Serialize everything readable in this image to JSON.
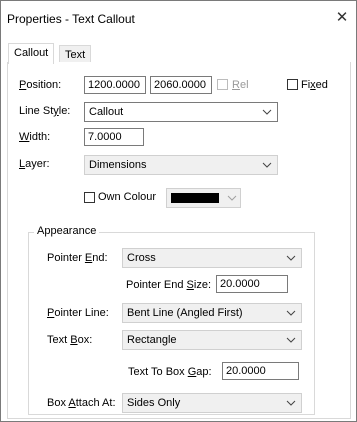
{
  "window": {
    "title": "Properties - Text Callout",
    "close_glyph": "✕"
  },
  "tabs": [
    {
      "label": "Callout",
      "active": true
    },
    {
      "label": "Text",
      "active": false
    }
  ],
  "position": {
    "label": "Position:",
    "x": "1200.0000",
    "y": "2060.0000",
    "rel_label": "Rel",
    "rel_checked": false,
    "rel_enabled": false,
    "fixed_label": "Fixed",
    "fixed_checked": false
  },
  "line_style": {
    "label": "Line Style:",
    "value": "Callout"
  },
  "width": {
    "label": "Width:",
    "value": "7.0000"
  },
  "layer": {
    "label": "Layer:",
    "value": "Dimensions"
  },
  "own_colour": {
    "label": "Own Colour",
    "checked": false,
    "colour": "#000000"
  },
  "appearance": {
    "title": "Appearance",
    "pointer_end": {
      "label": "Pointer End:",
      "value": "Cross"
    },
    "pointer_end_size": {
      "label": "Pointer End Size:",
      "value": "20.0000"
    },
    "pointer_line": {
      "label": "Pointer Line:",
      "value": "Bent Line (Angled First)"
    },
    "text_box": {
      "label": "Text Box:",
      "value": "Rectangle"
    },
    "text_to_box_gap": {
      "label": "Text To Box Gap:",
      "value": "20.0000"
    },
    "box_attach_at": {
      "label": "Box Attach At:",
      "value": "Sides Only"
    }
  },
  "icons": {
    "chevron": "chevron-down-icon",
    "close": "close-icon"
  }
}
